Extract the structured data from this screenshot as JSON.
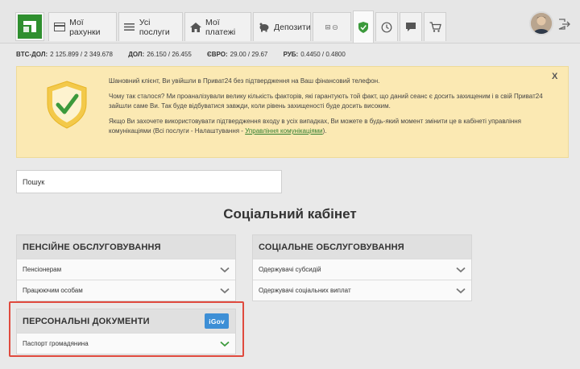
{
  "nav": {
    "tabs": [
      {
        "label": "Мої рахунки",
        "icon": "card-icon"
      },
      {
        "label": "Усі послуги",
        "icon": "list-icon"
      },
      {
        "label": "Мої платежі",
        "icon": "house-icon"
      },
      {
        "label": "Депозити",
        "icon": "piggy-bank-icon"
      }
    ],
    "icon_tabs": [
      "transfer-icon",
      "shield-icon",
      "clock-icon",
      "chat-icon",
      "cart-icon"
    ]
  },
  "rates": [
    {
      "label": "BTC-ДОЛ:",
      "value": "2 125.899 / 2 349.678"
    },
    {
      "label": "ДОЛ:",
      "value": "26.150 / 26.455"
    },
    {
      "label": "ЄВРО:",
      "value": "29.00 / 29.67"
    },
    {
      "label": "РУБ:",
      "value": "0.4450 / 0.4800"
    }
  ],
  "alert": {
    "close": "X",
    "p1": "Шановний клієнт, Ви увійшли в Приват24 без підтвердження на Ваш фінансовий телефон.",
    "p2": "Чому так сталося? Ми проаналізували велику кількість факторів, які гарантують той факт, що даний сеанс є досить захищеним і в свій Приват24 зайшли саме Ви. Так буде відбуватися завжди, коли рівень захищеності буде досить високим.",
    "p3": "Якщо Ви захочете використовувати підтвердження входу в усіх випадках, Ви можете в будь-який момент змінити це в кабінеті управління комунікаціями (Всі послуги - Налаштування - ",
    "p3_link": "Управління комунікаціями",
    "p3_end": ")."
  },
  "search": {
    "placeholder": "Пошук"
  },
  "page_title": "Соціальний кабінет",
  "cards": {
    "pension": {
      "title": "ПЕНСІЙНЕ ОБСЛУГОВУВАННЯ",
      "items": [
        "Пенсіонерам",
        "Працюючим особам"
      ]
    },
    "social": {
      "title": "СОЦІАЛЬНЕ ОБСЛУГОВУВАННЯ",
      "items": [
        "Одержувачі субсидій",
        "Одержувачі соціальних виплат"
      ]
    },
    "personal": {
      "title": "ПЕРСОНАЛЬНІ ДОКУМЕНТИ",
      "badge": "iGov",
      "items": [
        "Паспорт громадянина"
      ]
    }
  },
  "colors": {
    "brand": "#2f8f2f",
    "alert_bg": "#fbe9b3",
    "highlight": "#e04a3e",
    "igov": "#3d8fd6",
    "chevron_active": "#3c9a3c"
  }
}
